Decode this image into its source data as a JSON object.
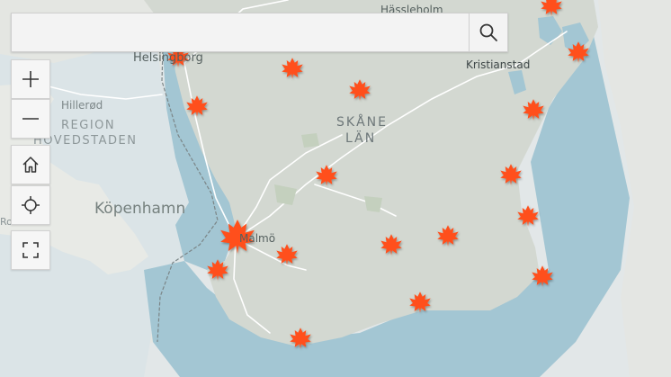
{
  "search": {
    "placeholder": "",
    "value": "",
    "button_icon": "search-icon"
  },
  "controls": {
    "zoom_in_icon": "plus-icon",
    "zoom_out_icon": "minus-icon",
    "home_icon": "home-icon",
    "locate_icon": "crosshair-icon",
    "fullscreen_icon": "fullscreen-icon"
  },
  "labels": {
    "helsingborg": "Helsingborg",
    "hassleholm": "Hässleholm",
    "kristianstad": "Kristianstad",
    "hillerod": "Hillerød",
    "region": "REGION",
    "hovedstaden": "HOVEDSTADEN",
    "kopenhamn": "Köpenhamn",
    "roskilde": "Roskilde",
    "skane": "SKÅNE",
    "lan": "LÄN",
    "malmo": "Malmö"
  },
  "colors": {
    "water": "#a3c6d3",
    "land_sweden": "#d4d8d2",
    "land_outside": "#e3e6e5",
    "marker": "#ff4f1a",
    "road": "#ffffff"
  },
  "marker_icon": "maple-leaf-icon"
}
